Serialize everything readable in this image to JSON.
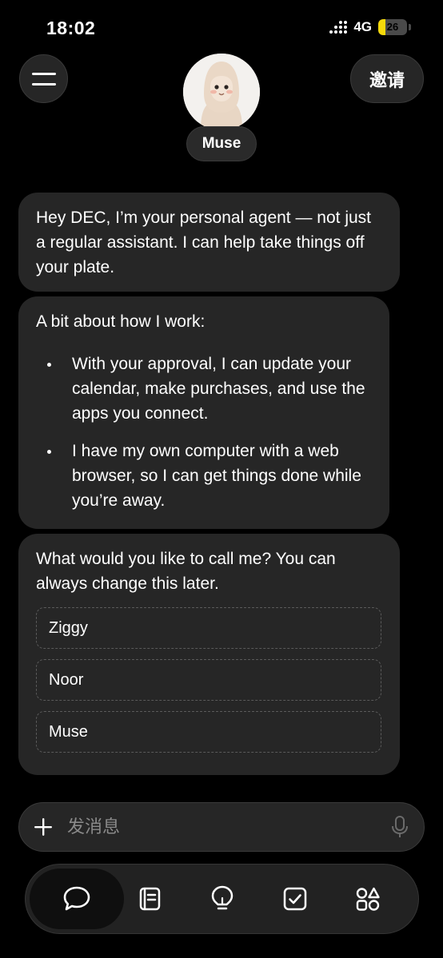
{
  "status_bar": {
    "time": "18:02",
    "network": "4G",
    "battery": "26",
    "battery_level": 0.26
  },
  "header": {
    "invite_label": "邀请",
    "agent_name": "Muse"
  },
  "chat": {
    "intro": "Hey DEC, I’m your personal agent — not just a regular assistant. I can help take things off your plate.",
    "how_title": "A bit about how I work:",
    "how_points": [
      "With your approval, I can update your calendar, make purchases, and use the apps you connect.",
      "I have my own computer with a web browser, so I can get things done while you’re away."
    ],
    "name_question": "What would you like to call me? You can always change this later.",
    "name_options": [
      "Ziggy",
      "Noor",
      "Muse"
    ]
  },
  "composer": {
    "placeholder": "发消息"
  },
  "tabs": [
    {
      "name": "chat",
      "icon": "chat-bubble-icon",
      "active": true
    },
    {
      "name": "notes",
      "icon": "notebook-icon",
      "active": false
    },
    {
      "name": "ideas",
      "icon": "lightbulb-icon",
      "active": false
    },
    {
      "name": "tasks",
      "icon": "checkbox-icon",
      "active": false
    },
    {
      "name": "apps",
      "icon": "shapes-icon",
      "active": false
    }
  ],
  "colors": {
    "background": "#000000",
    "bubble": "#262626",
    "battery_fill": "#f5d90a"
  }
}
